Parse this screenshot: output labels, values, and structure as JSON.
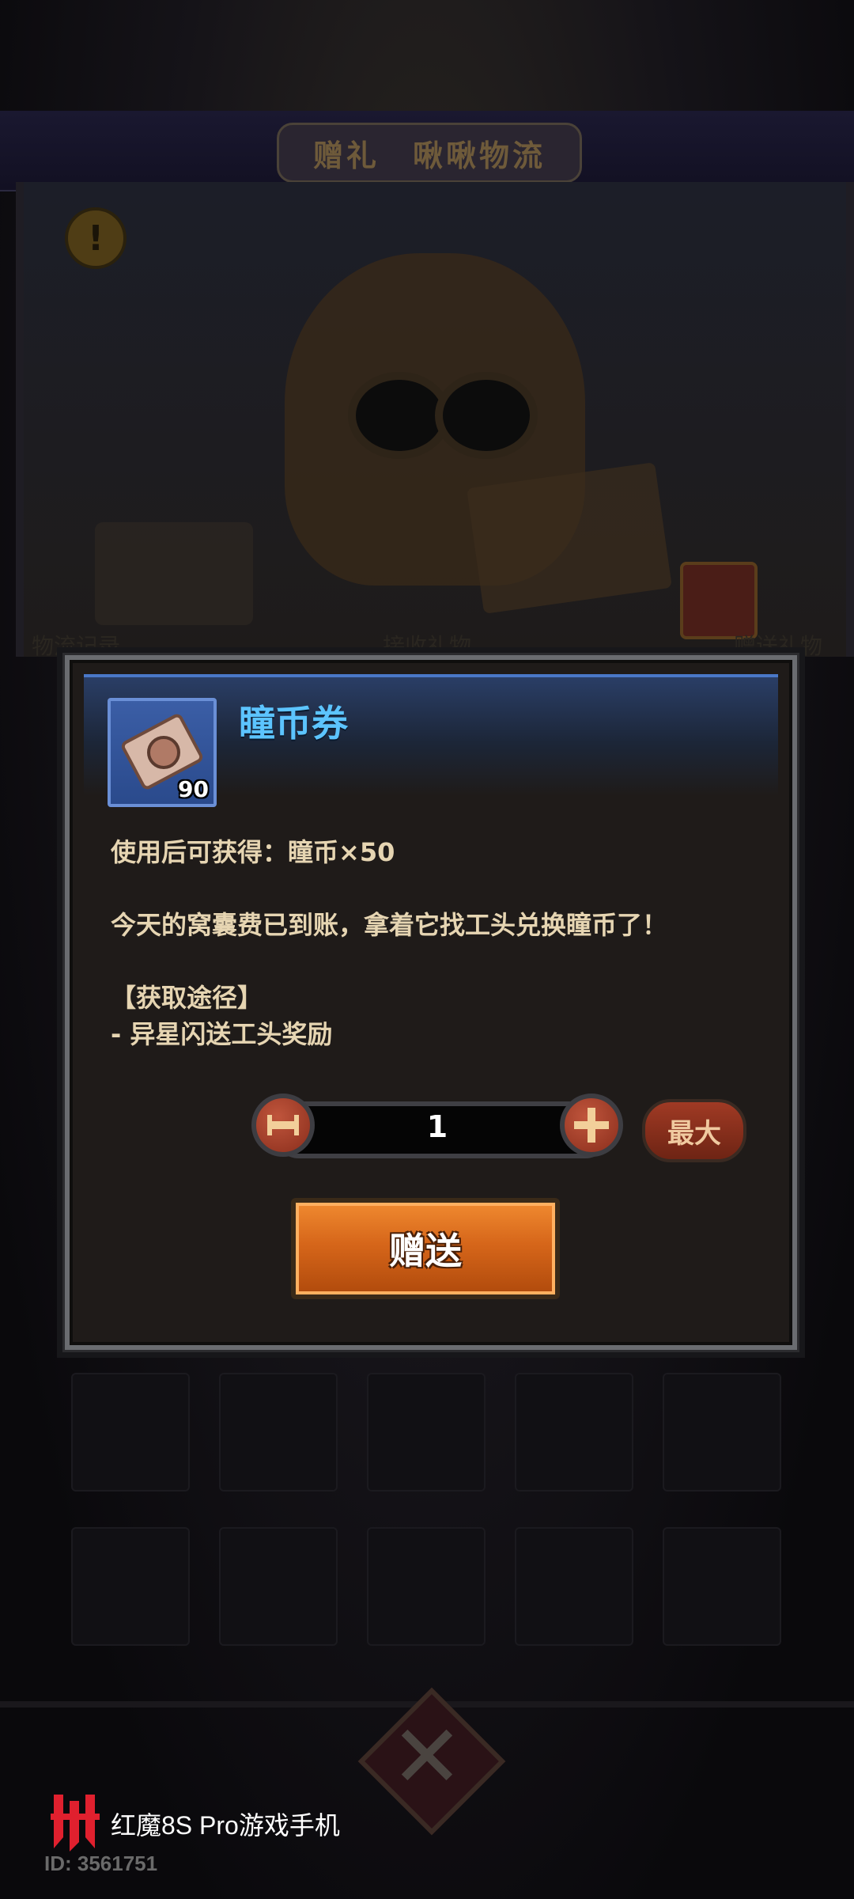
{
  "header": {
    "title": "赠礼　啾啾物流"
  },
  "background_tabs": [
    "物流记录",
    "接收礼物",
    "赠送礼物"
  ],
  "item": {
    "name": "瞳币券",
    "count": "90",
    "icon": "coin-ticket-icon",
    "title_color": "#5cc4ff"
  },
  "description": {
    "line1": "使用后可获得：瞳币×50",
    "line2": "今天的窝囊费已到账，拿着它找工头兑换瞳币了！",
    "line3": "【获取途径】",
    "line4": "- 异星闪送工头奖励"
  },
  "stepper": {
    "value": "1",
    "minus_icon": "minus-icon",
    "plus_icon": "plus-icon"
  },
  "buttons": {
    "max": "最大",
    "send": "赠送",
    "send_color": "#e07020"
  },
  "watermark": {
    "brand": "红魔8S Pro游戏手机",
    "id": "ID: 3561751"
  }
}
